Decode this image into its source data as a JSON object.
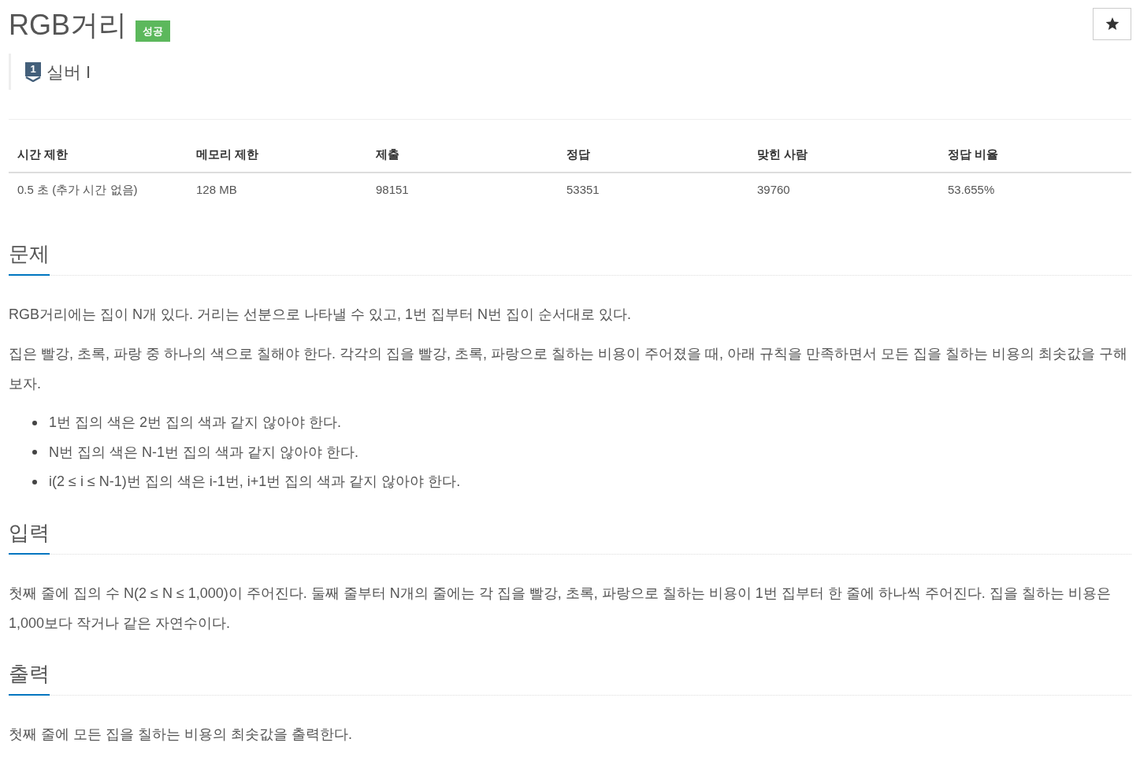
{
  "title": "RGB거리",
  "result_badge": {
    "label": "성공",
    "kind": "success"
  },
  "tier": {
    "number": "1",
    "label": "실버 I",
    "kind": "silver"
  },
  "info_table": {
    "columns": [
      "시간 제한",
      "메모리 제한",
      "제출",
      "정답",
      "맞힌 사람",
      "정답 비율"
    ],
    "rows": [
      [
        "0.5 초 (추가 시간 없음)",
        "128 MB",
        "98151",
        "53351",
        "39760",
        "53.655%"
      ]
    ]
  },
  "sections": [
    {
      "heading": "문제",
      "blocks": [
        {
          "kind": "paragraph",
          "text": "RGB거리에는 집이 N개 있다. 거리는 선분으로 나타낼 수 있고, 1번 집부터 N번 집이 순서대로 있다."
        },
        {
          "kind": "paragraph",
          "text": "집은 빨강, 초록, 파랑 중 하나의 색으로 칠해야 한다. 각각의 집을 빨강, 초록, 파랑으로 칠하는 비용이 주어졌을 때, 아래 규칙을 만족하면서 모든 집을 칠하는 비용의 최솟값을 구해보자."
        },
        {
          "kind": "list",
          "items": [
            "1번 집의 색은 2번 집의 색과 같지 않아야 한다.",
            "N번 집의 색은 N-1번 집의 색과 같지 않아야 한다.",
            "i(2 ≤ i ≤ N-1)번 집의 색은 i-1번, i+1번 집의 색과 같지 않아야 한다."
          ]
        }
      ]
    },
    {
      "heading": "입력",
      "blocks": [
        {
          "kind": "paragraph",
          "text": "첫째 줄에 집의 수 N(2 ≤ N ≤ 1,000)이 주어진다. 둘째 줄부터 N개의 줄에는 각 집을 빨강, 초록, 파랑으로 칠하는 비용이 1번 집부터 한 줄에 하나씩 주어진다. 집을 칠하는 비용은 1,000보다 작거나 같은 자연수이다."
        }
      ]
    },
    {
      "heading": "출력",
      "blocks": [
        {
          "kind": "paragraph",
          "text": "첫째 줄에 모든 집을 칠하는 비용의 최솟값을 출력한다."
        }
      ]
    }
  ]
}
